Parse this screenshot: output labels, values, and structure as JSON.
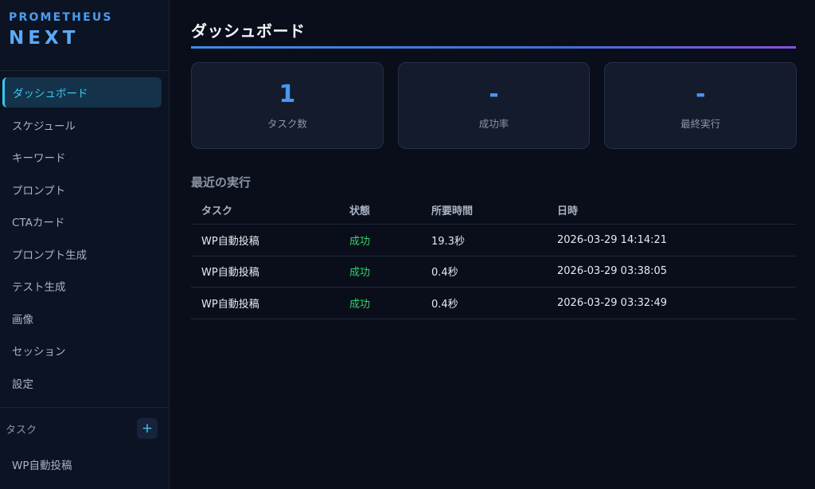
{
  "brand": {
    "top": "PROMETHEUS",
    "bottom": "NEXT"
  },
  "sidebar": {
    "items": [
      {
        "label": "ダッシュボード"
      },
      {
        "label": "スケジュール"
      },
      {
        "label": "キーワード"
      },
      {
        "label": "プロンプト"
      },
      {
        "label": "CTAカード"
      },
      {
        "label": "プロンプト生成"
      },
      {
        "label": "テスト生成"
      },
      {
        "label": "画像"
      },
      {
        "label": "セッション"
      },
      {
        "label": "設定"
      }
    ],
    "task_section": {
      "label": "タスク",
      "add_label": "+"
    },
    "tasks": [
      {
        "label": "WP自動投稿"
      }
    ]
  },
  "main": {
    "title": "ダッシュボード",
    "cards": [
      {
        "value": "1",
        "label": "タスク数"
      },
      {
        "value": "-",
        "label": "成功率"
      },
      {
        "value": "-",
        "label": "最終実行"
      }
    ],
    "recent": {
      "title": "最近の実行",
      "columns": [
        "タスク",
        "状態",
        "所要時間",
        "日時"
      ],
      "rows": [
        [
          "WP自動投稿",
          "成功",
          "19.3秒",
          "2026-03-29 14:14:21"
        ],
        [
          "WP自動投稿",
          "成功",
          "0.4秒",
          "2026-03-29 03:38:05"
        ],
        [
          "WP自動投稿",
          "成功",
          "0.4秒",
          "2026-03-29 03:32:49"
        ]
      ]
    }
  },
  "colors": {
    "accent": "#38c8ef",
    "card_value": "#4a96f2",
    "success": "#2fd46b",
    "background": "#0a0e1a"
  }
}
